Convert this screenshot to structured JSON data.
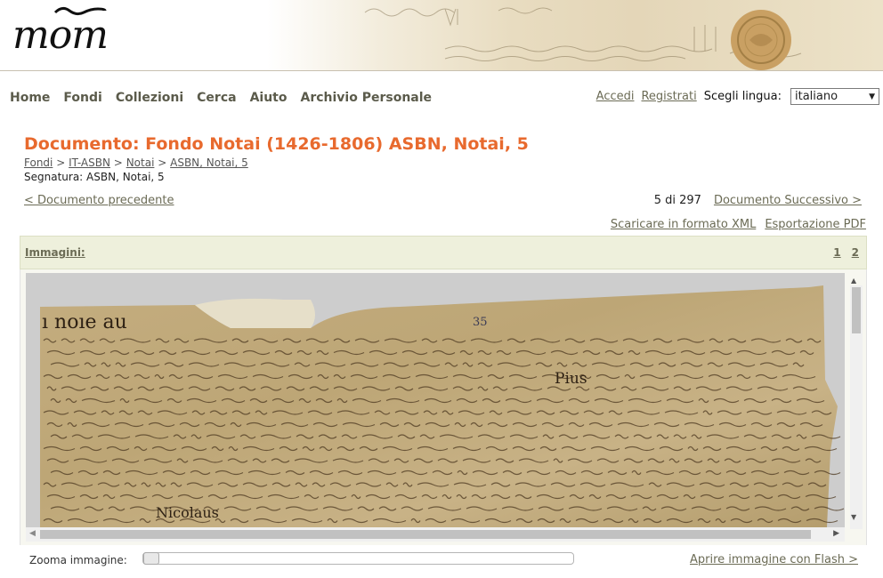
{
  "logo": {
    "text": "mom"
  },
  "banner": {
    "seal_color": "#c9a063"
  },
  "nav": {
    "items": [
      {
        "label": "Home"
      },
      {
        "label": "Fondi"
      },
      {
        "label": "Collezioni"
      },
      {
        "label": "Cerca"
      },
      {
        "label": "Aiuto"
      },
      {
        "label": "Archivio Personale"
      }
    ]
  },
  "account": {
    "login": "Accedi",
    "register": "Registrati"
  },
  "language": {
    "label": "Scegli lingua:",
    "selected": "italiano"
  },
  "document": {
    "title": "Documento: Fondo Notai (1426-1806) ASBN, Notai, 5",
    "breadcrumb": [
      "Fondi",
      "IT-ASBN",
      "Notai",
      "ASBN, Notai, 5"
    ],
    "separator": ">",
    "segnatura": "Segnatura: ASBN, Notai, 5"
  },
  "pager": {
    "prev": "< Documento precedente",
    "count": "5 di 297",
    "next": "Documento Successivo >"
  },
  "export": {
    "xml": "Scaricare in formato XML",
    "pdf": "Esportazione PDF"
  },
  "images": {
    "label": "Immagini:",
    "pages": [
      "1",
      "2"
    ],
    "manuscript_visible_words": [
      "Nicolaus",
      "Pius",
      "35"
    ]
  },
  "zoom": {
    "label": "Zooma immagine:",
    "level": 0
  },
  "flash": {
    "label": "Aprire immagine con Flash >"
  },
  "colors": {
    "title": "#e86a2e",
    "link": "#6b6b55",
    "panel": "#eef0dc"
  }
}
